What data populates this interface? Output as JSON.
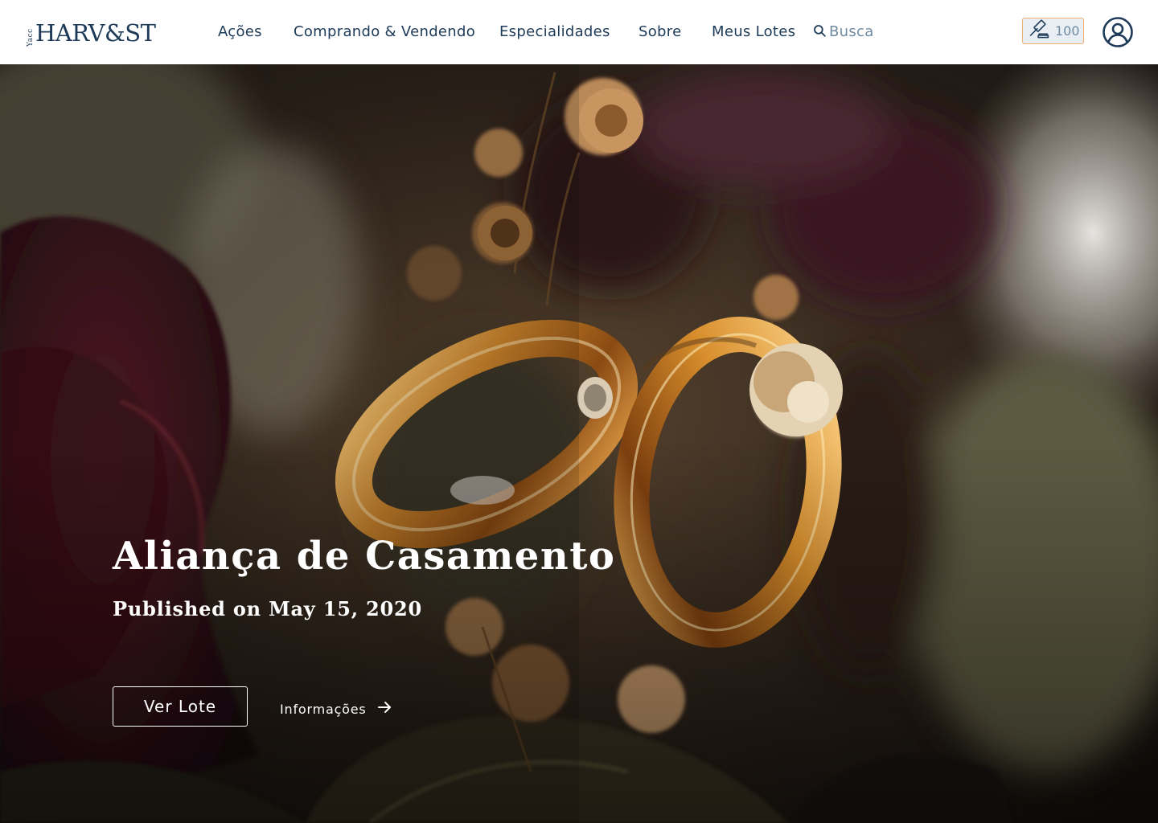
{
  "header": {
    "logo": {
      "small_text": "Yacc",
      "main_text": "HARV&ST"
    },
    "nav": {
      "acoes": "Ações",
      "comprando": "Comprando & Vendendo",
      "especialidades": "Especialidades",
      "sobre": "Sobre",
      "meus_lotes": "Meus Lotes"
    },
    "search": {
      "placeholder": "Busca",
      "icon": "search-icon"
    },
    "bids": {
      "count": "100",
      "icon": "gavel-icon"
    },
    "profile": {
      "icon": "user-circle-icon"
    }
  },
  "hero": {
    "title": "Aliança de Casamento",
    "subtitle": "Published on May 15, 2020",
    "primary_button": "Ver Lote",
    "secondary_link": "Informações",
    "secondary_icon": "arrow-right-icon",
    "image_subject": "gold-wedding-rings-with-dried-flowers"
  },
  "colors": {
    "brand_navy": "#1d3a58",
    "muted_blue": "#6f8aa1",
    "badge_border": "#f0b16e",
    "badge_bg": "#e8eef4",
    "hero_text": "#ffffff"
  }
}
